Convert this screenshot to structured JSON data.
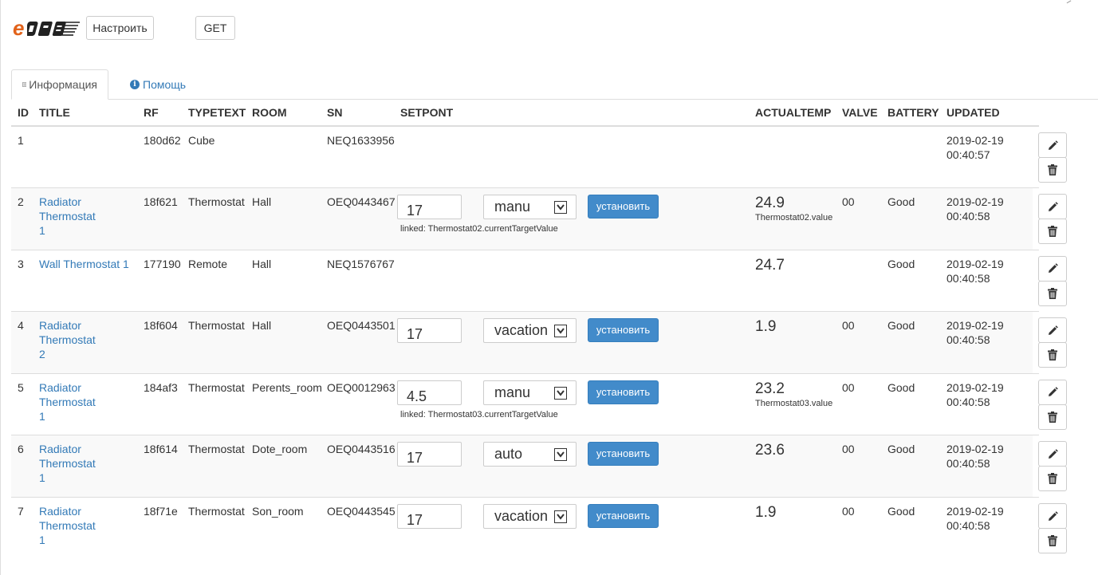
{
  "header": {
    "logo_text": "eQ-3",
    "configure_label": "Настроить",
    "get_label": "GET"
  },
  "tabs": [
    {
      "label": "Информация",
      "icon": "list-icon",
      "active": true
    },
    {
      "label": "Помощь",
      "icon": "info-icon",
      "active": false
    }
  ],
  "table": {
    "columns": [
      "ID",
      "TITLE",
      "RF",
      "TYPETEXT",
      "ROOM",
      "SN",
      "SETPONT",
      "ACTUALTEMP",
      "VALVE",
      "BATTERY",
      "UPDATED"
    ],
    "setpoint_button_label": "установить",
    "rows": [
      {
        "id": "1",
        "title_line1": "",
        "title_line2": "",
        "rf": "180d62",
        "type": "Cube",
        "room": "",
        "sn": "NEQ1633956",
        "setpoint": null,
        "mode": null,
        "linked": "",
        "actualtemp": "",
        "actual_linked": "",
        "valve": "",
        "battery": "",
        "updated_date": "2019-02-19",
        "updated_time": "00:40:57"
      },
      {
        "id": "2",
        "title_line1": "Radiator Thermostat",
        "title_line2": "1",
        "rf": "18f621",
        "type": "Thermostat",
        "room": "Hall",
        "sn": "OEQ0443467",
        "setpoint": "17",
        "mode": "manu",
        "linked": "linked: Thermostat02.currentTargetValue",
        "actualtemp": "24.9",
        "actual_linked": "Thermostat02.value",
        "valve": "00",
        "battery": "Good",
        "updated_date": "2019-02-19",
        "updated_time": "00:40:58"
      },
      {
        "id": "3",
        "title_line1": "Wall Thermostat 1",
        "title_line2": "",
        "rf": "177190",
        "type": "Remote",
        "room": "Hall",
        "sn": "NEQ1576767",
        "setpoint": null,
        "mode": null,
        "linked": "",
        "actualtemp": "24.7",
        "actual_linked": "",
        "valve": "",
        "battery": "Good",
        "updated_date": "2019-02-19",
        "updated_time": "00:40:58"
      },
      {
        "id": "4",
        "title_line1": "Radiator Thermostat",
        "title_line2": "2",
        "rf": "18f604",
        "type": "Thermostat",
        "room": "Hall",
        "sn": "OEQ0443501",
        "setpoint": "17",
        "mode": "vacation",
        "linked": "",
        "actualtemp": "1.9",
        "actual_linked": "",
        "valve": "00",
        "battery": "Good",
        "updated_date": "2019-02-19",
        "updated_time": "00:40:58"
      },
      {
        "id": "5",
        "title_line1": "Radiator Thermostat",
        "title_line2": "1",
        "rf": "184af3",
        "type": "Thermostat",
        "room": "Perents_room",
        "sn": "OEQ0012963",
        "setpoint": "4.5",
        "mode": "manu",
        "linked": "linked: Thermostat03.currentTargetValue",
        "actualtemp": "23.2",
        "actual_linked": "Thermostat03.value",
        "valve": "00",
        "battery": "Good",
        "updated_date": "2019-02-19",
        "updated_time": "00:40:58"
      },
      {
        "id": "6",
        "title_line1": "Radiator Thermostat",
        "title_line2": "1",
        "rf": "18f614",
        "type": "Thermostat",
        "room": "Dote_room",
        "sn": "OEQ0443516",
        "setpoint": "17",
        "mode": "auto",
        "linked": "",
        "actualtemp": "23.6",
        "actual_linked": "",
        "valve": "00",
        "battery": "Good",
        "updated_date": "2019-02-19",
        "updated_time": "00:40:58"
      },
      {
        "id": "7",
        "title_line1": "Radiator Thermostat",
        "title_line2": "1",
        "rf": "18f71e",
        "type": "Thermostat",
        "room": "Son_room",
        "sn": "OEQ0443545",
        "setpoint": "17",
        "mode": "vacation",
        "linked": "",
        "actualtemp": "1.9",
        "actual_linked": "",
        "valve": "00",
        "battery": "Good",
        "updated_date": "2019-02-19",
        "updated_time": "00:40:58"
      }
    ]
  },
  "colors": {
    "link": "#337ab7",
    "primary_button": "#428bca",
    "logo_orange": "#e2631b"
  }
}
